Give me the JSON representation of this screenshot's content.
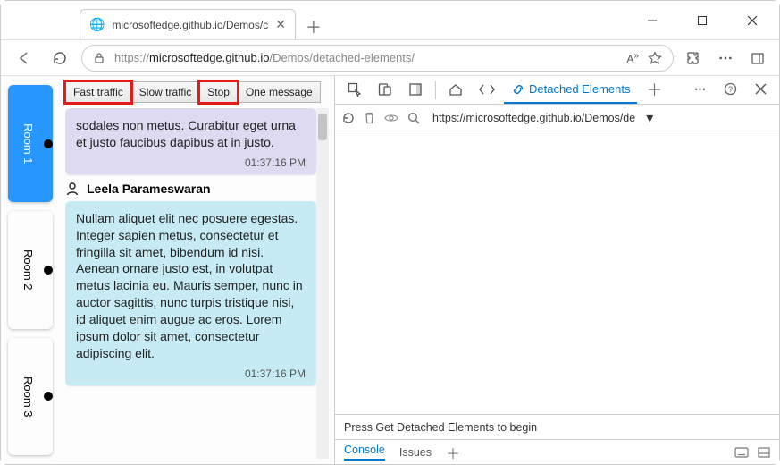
{
  "browser": {
    "tab_title": "microsoftedge.github.io/Demos/c",
    "url_prefix": "https://",
    "url_host": "microsoftedge.github.io",
    "url_path": "/Demos/detached-elements/"
  },
  "rooms": [
    {
      "label": "Room 1",
      "active": true
    },
    {
      "label": "Room 2",
      "active": false
    },
    {
      "label": "Room 3",
      "active": false
    }
  ],
  "traffic_buttons": {
    "fast": "Fast traffic",
    "slow": "Slow traffic",
    "stop": "Stop",
    "one": "One message"
  },
  "messages": [
    {
      "body": "sodales non metus. Curabitur eget urna et justo faucibus dapibus at in justo.",
      "time": "01:37:16 PM",
      "style": "msg1"
    },
    {
      "user": "Leela Parameswaran",
      "body": "Nullam aliquet elit nec posuere egestas. Integer sapien metus, consectetur et fringilla sit amet, bibendum id nisi. Aenean ornare justo est, in volutpat metus lacinia eu. Mauris semper, nunc in auctor sagittis, nunc turpis tristique nisi, id aliquet enim augue ac eros. Lorem ipsum dolor sit amet, consectetur adipiscing elit.",
      "time": "01:37:16 PM",
      "style": "msg2"
    }
  ],
  "devtools": {
    "active_tab": "Detached Elements",
    "toolbar_url": "https://microsoftedge.github.io/Demos/de",
    "status_text": "Press Get Detached Elements to begin",
    "drawer_tabs": {
      "console": "Console",
      "issues": "Issues"
    }
  }
}
